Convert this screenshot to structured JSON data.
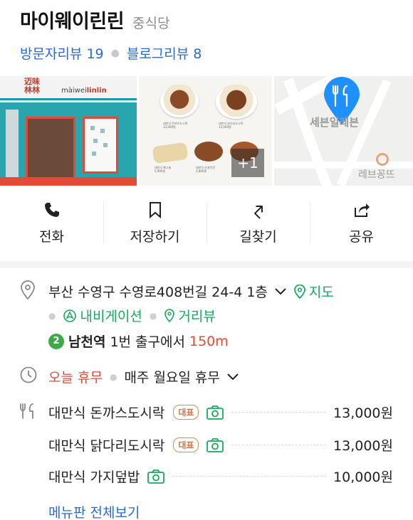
{
  "place": {
    "name": "마이웨이린린",
    "category": "중식당",
    "visitor_reviews": "방문자리뷰 19",
    "blog_reviews": "블로그리뷰 8"
  },
  "photos": {
    "store_sign_cn": "迈味\n林林",
    "store_brand_prefix": "màiwei",
    "store_brand_suffix": "linlin",
    "more_count": "+1",
    "map_label_1": "세븐일레븐",
    "map_label_2": "레브꽁뜨"
  },
  "actions": [
    {
      "label": "전화",
      "icon": "phone-icon"
    },
    {
      "label": "저장하기",
      "icon": "bookmark-icon"
    },
    {
      "label": "길찾기",
      "icon": "directions-icon"
    },
    {
      "label": "공유",
      "icon": "share-icon"
    }
  ],
  "address": {
    "text": "부산 수영구 수영로408번길 24-4 1층",
    "map_link": "지도",
    "navigation_link": "내비게이션",
    "street_view_link": "거리뷰"
  },
  "subway": {
    "line": "2",
    "station": "남천역",
    "exit": "1번 출구에서",
    "distance": "150m"
  },
  "hours": {
    "status": "오늘 휴무",
    "detail": "매주 월요일 휴무"
  },
  "menu": {
    "items": [
      {
        "name": "대만식 돈까스도시락",
        "badge": "대표",
        "price": "13,000원"
      },
      {
        "name": "대만식 닭다리도시락",
        "badge": "대표",
        "price": "13,000원"
      },
      {
        "name": "대만식 가지덮밥",
        "badge": "",
        "price": "10,000원"
      }
    ],
    "view_all": "메뉴판 전체보기"
  },
  "colors": {
    "link_blue": "#2b6ad1",
    "green": "#17a95c",
    "red": "#e34a3a",
    "badge_orange": "#e0703a",
    "map_pin_blue": "#1e90ff"
  }
}
